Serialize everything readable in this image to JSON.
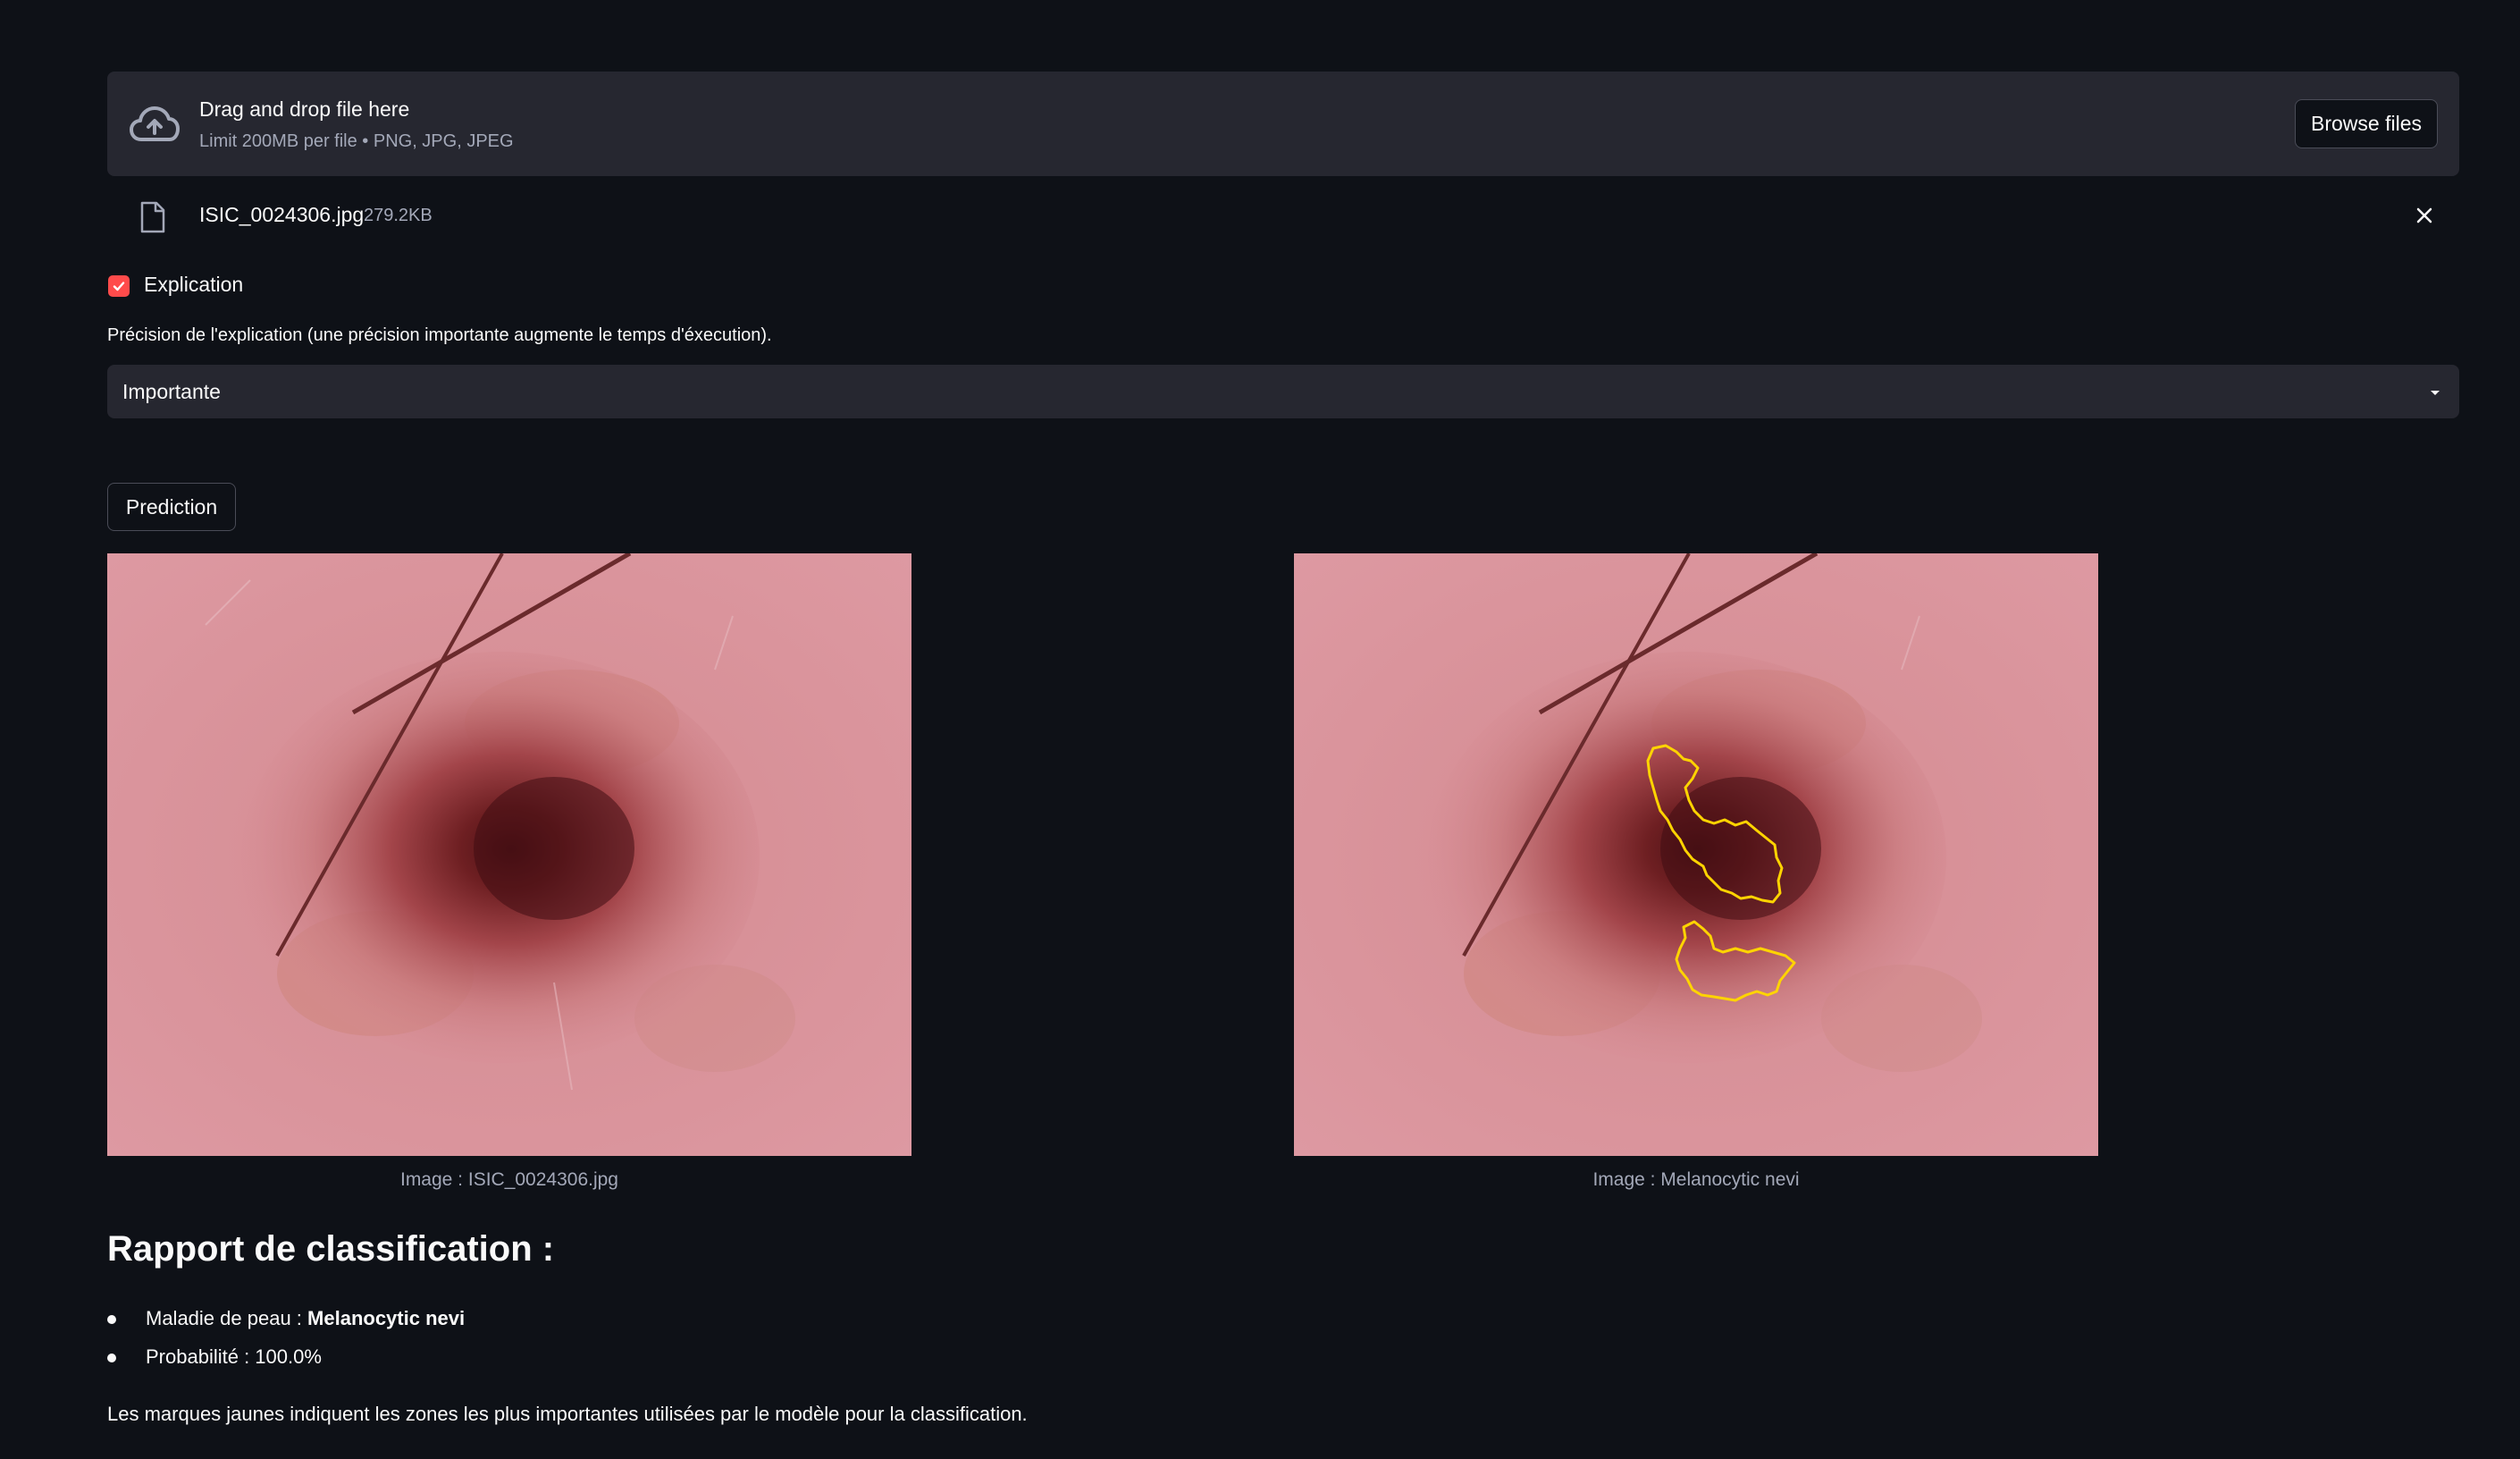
{
  "uploader": {
    "title": "Drag and drop file here",
    "limit": "Limit 200MB per file • PNG, JPG, JPEG",
    "browse_label": "Browse files"
  },
  "file": {
    "name": "ISIC_0024306.jpg",
    "size": "279.2KB"
  },
  "explanation_checkbox": {
    "label": "Explication",
    "checked": true
  },
  "precision_select": {
    "label": "Précision de l'explication (une précision importante augmente le temps d'éxecution).",
    "value": "Importante"
  },
  "predict_button": {
    "label": "Prediction"
  },
  "images": {
    "left_caption": "Image : ISIC_0024306.jpg",
    "right_caption": "Image : Melanocytic nevi"
  },
  "report": {
    "title": "Rapport de classification :",
    "disease_prefix": "Maladie de peau : ",
    "disease_value": "Melanocytic nevi",
    "probability": "Probabilité : 100.0%",
    "note": "Les marques jaunes indiquent les zones les plus importantes utilisées par le modèle pour la classification."
  },
  "colors": {
    "background": "#0e1117",
    "widget": "#262730",
    "accent": "#ff4b4b",
    "highlight": "#ffd700"
  },
  "icons": {
    "upload": "cloud-upload-icon",
    "file": "file-icon",
    "close": "close-icon",
    "check": "check-icon",
    "dropdown": "chevron-down-icon"
  }
}
